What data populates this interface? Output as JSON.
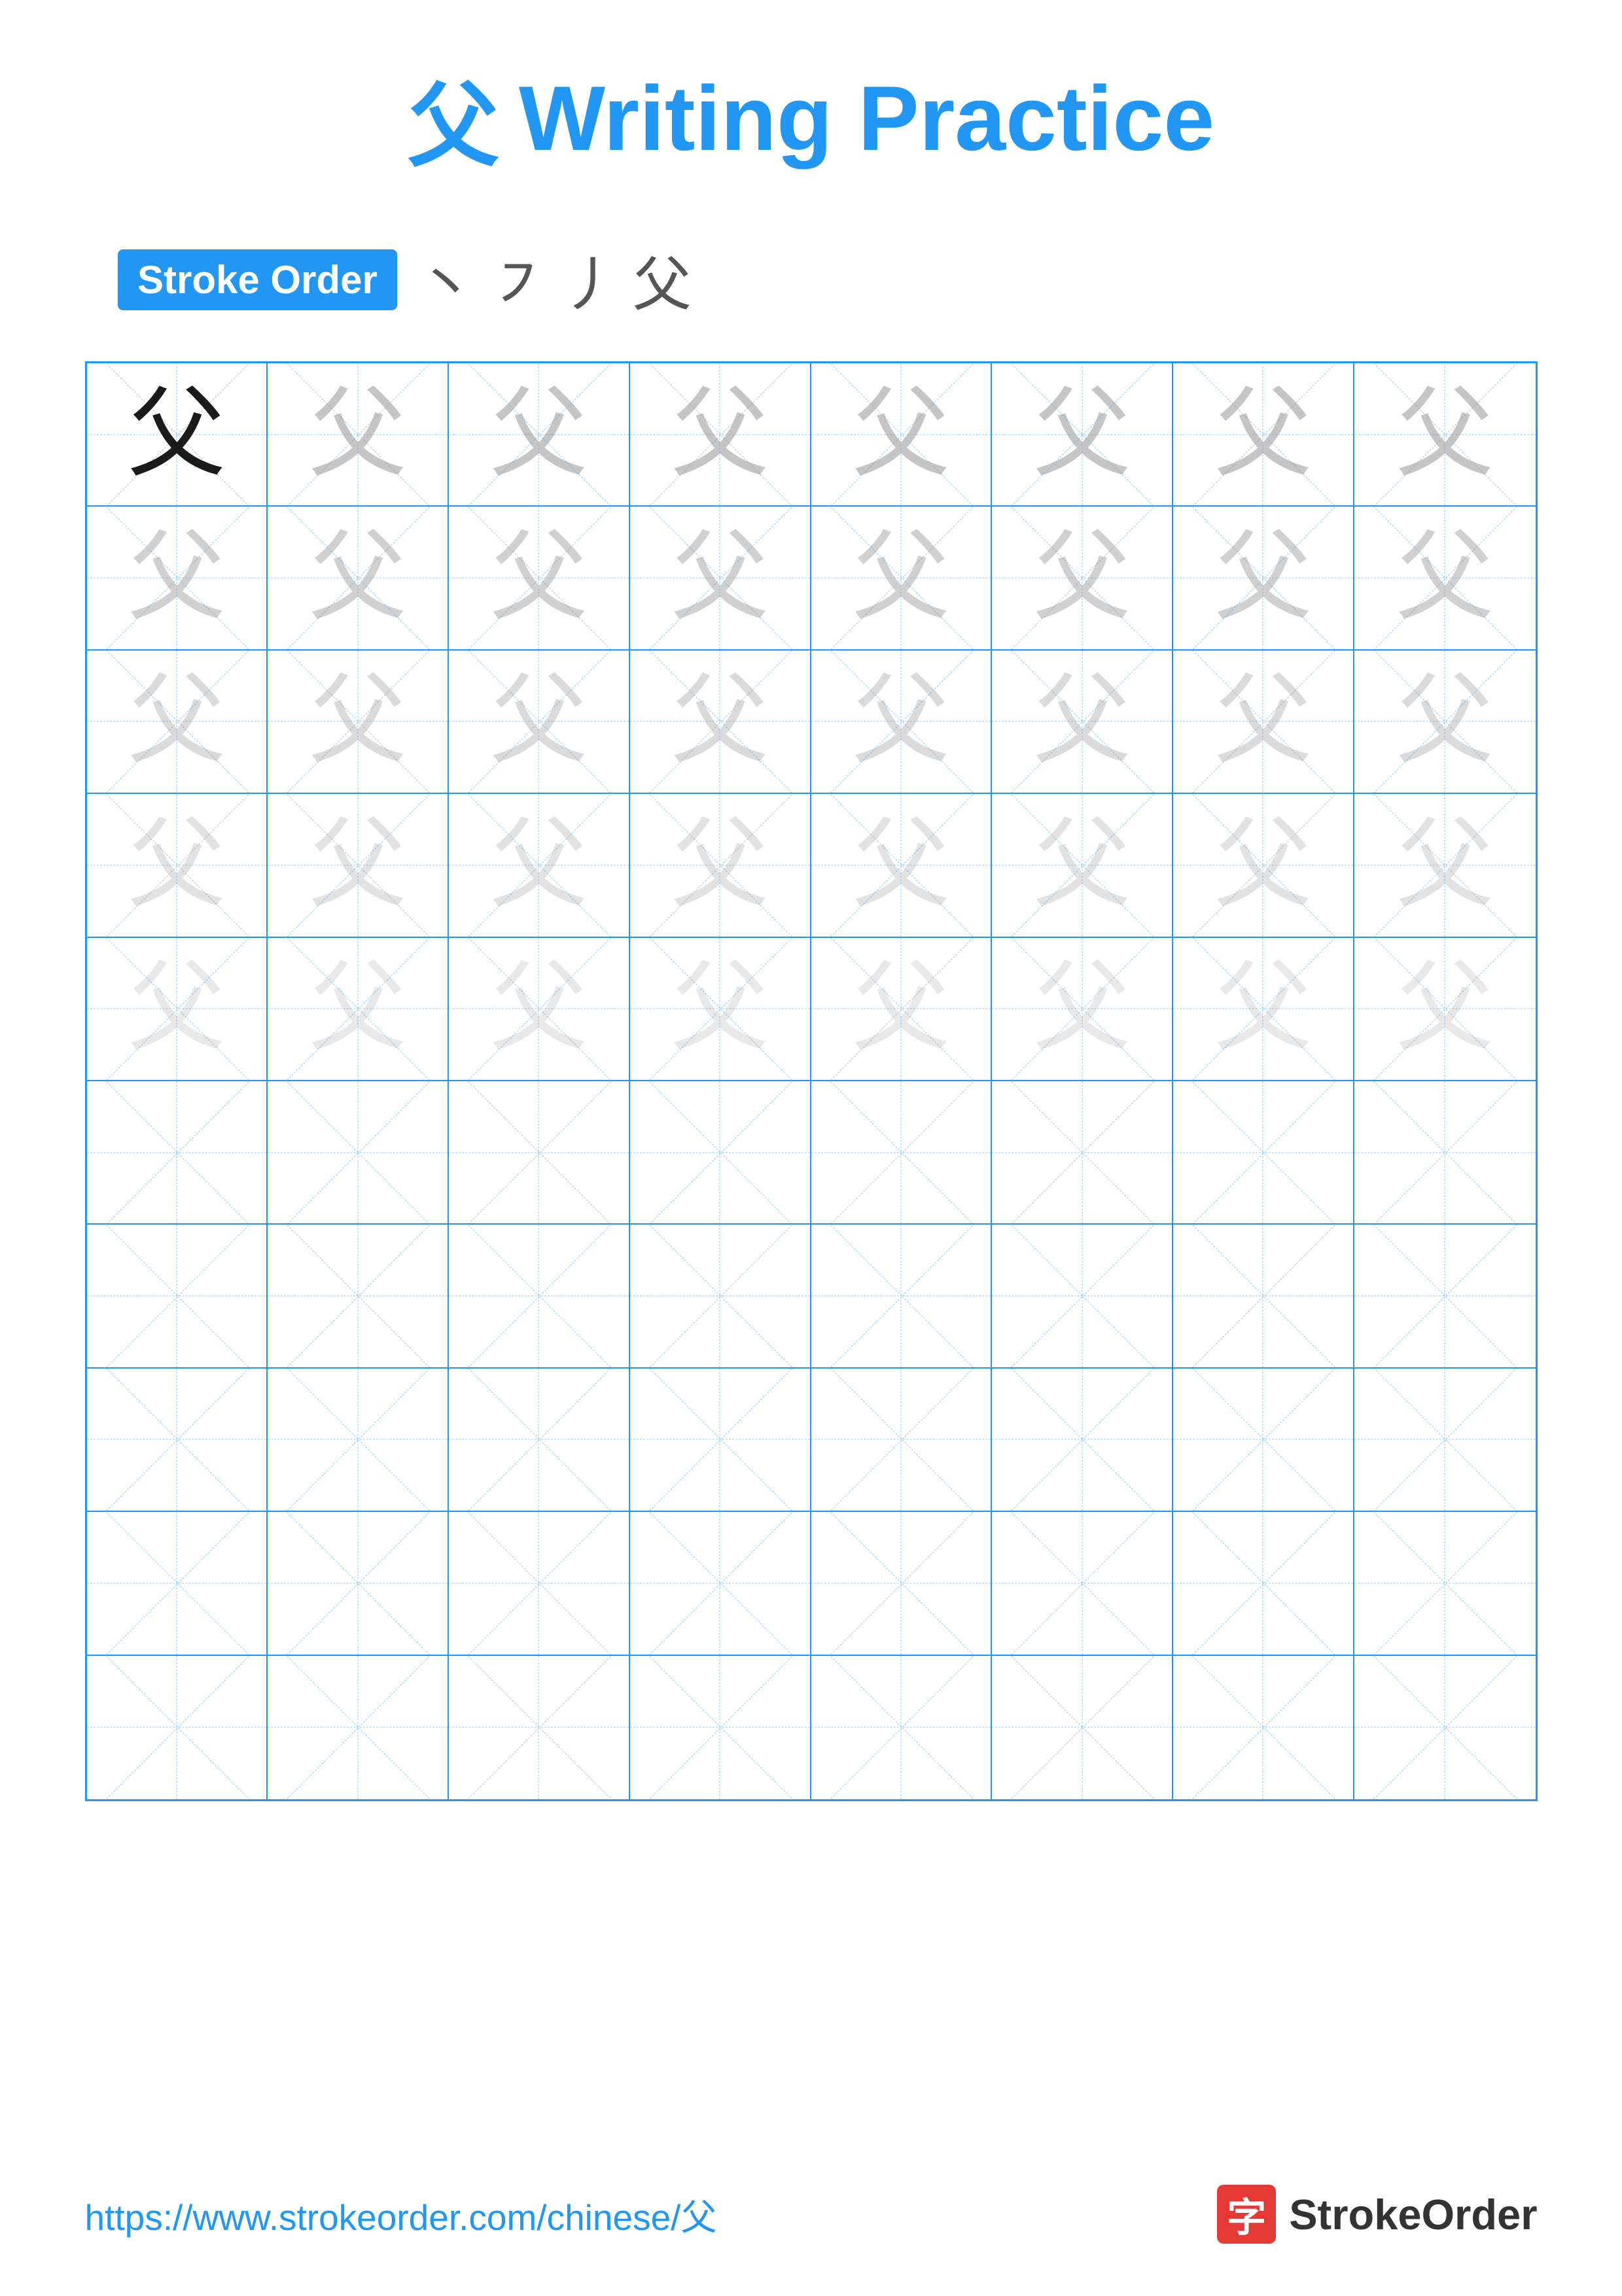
{
  "title": {
    "char": "父",
    "text": "Writing Practice"
  },
  "strokeOrder": {
    "badge": "Stroke Order",
    "chars": [
      "丶",
      "㇇",
      "丿",
      "父"
    ]
  },
  "grid": {
    "cols": 8,
    "rows": 10,
    "practiceChar": "父",
    "filledRows": 5
  },
  "footer": {
    "url": "https://www.strokeorder.com/chinese/父",
    "logoChar": "字",
    "logoText": "StrokeOrder"
  }
}
